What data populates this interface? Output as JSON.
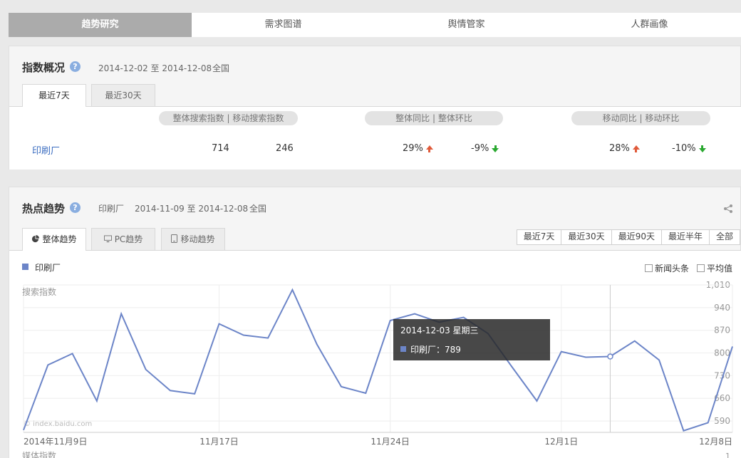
{
  "nav": {
    "items": [
      {
        "label": "趋势研究",
        "active": true
      },
      {
        "label": "需求图谱",
        "active": false
      },
      {
        "label": "舆情管家",
        "active": false
      },
      {
        "label": "人群画像",
        "active": false
      }
    ]
  },
  "overview": {
    "title": "指数概况",
    "help": "?",
    "date_range": "2014-12-02 至 2014-12-08",
    "region": "全国",
    "tabs": [
      {
        "label": "最近7天",
        "active": true
      },
      {
        "label": "最近30天",
        "active": false
      }
    ],
    "headers": {
      "search": "整体搜索指数 | 移动搜索指数",
      "overall": "整体同比 | 整体环比",
      "mobile": "移动同比 | 移动环比"
    },
    "row": {
      "keyword": "印刷厂",
      "overall_search": "714",
      "mobile_search": "246",
      "overall_yoy": "29%",
      "overall_mom": "-9%",
      "mobile_yoy": "28%",
      "mobile_mom": "-10%"
    },
    "colors": {
      "up": "#e05a3a",
      "down": "#2aa830",
      "link": "#3a6cc0"
    }
  },
  "trend": {
    "title": "热点趋势",
    "help": "?",
    "keyword": "印刷厂",
    "date_range": "2014-11-09 至 2014-12-08",
    "region": "全国",
    "tabs": [
      {
        "label": "整体趋势",
        "icon": "pie-chart-icon",
        "active": true
      },
      {
        "label": "PC趋势",
        "icon": "monitor-icon",
        "active": false
      },
      {
        "label": "移动趋势",
        "icon": "mobile-icon",
        "active": false
      }
    ],
    "ranges": [
      "最近7天",
      "最近30天",
      "最近90天",
      "最近半年",
      "全部"
    ],
    "legend": "印刷厂",
    "checkboxes": [
      "新闻头条",
      "平均值"
    ],
    "y_axis_label": "搜索指数",
    "watermark": "© index.baidu.com",
    "bottom_cut_label": "媒体指数",
    "bottom_cut_value": "1",
    "tooltip": {
      "date": "2014-12-03 星期三",
      "label": "印刷厂：789"
    }
  },
  "chart_data": {
    "type": "line",
    "ylabel": "搜索指数",
    "ylim": [
      555,
      1010
    ],
    "y_ticks": [
      "590",
      "660",
      "730",
      "800",
      "870",
      "940",
      "1,010"
    ],
    "y_tick_values": [
      590,
      660,
      730,
      800,
      870,
      940,
      1010
    ],
    "x_tick_labels": [
      "2014年11月9日",
      "11月17日",
      "11月24日",
      "12月1日",
      "12月8日"
    ],
    "x_tick_dates": [
      "2014-11-09",
      "2014-11-17",
      "2014-11-24",
      "2014-12-01",
      "2014-12-08"
    ],
    "series": [
      {
        "name": "印刷厂",
        "color": "#6c85c8",
        "x": [
          "2014-11-09",
          "2014-11-10",
          "2014-11-11",
          "2014-11-12",
          "2014-11-13",
          "2014-11-14",
          "2014-11-15",
          "2014-11-16",
          "2014-11-17",
          "2014-11-18",
          "2014-11-19",
          "2014-11-20",
          "2014-11-21",
          "2014-11-22",
          "2014-11-23",
          "2014-11-24",
          "2014-11-25",
          "2014-11-26",
          "2014-11-27",
          "2014-11-28",
          "2014-11-29",
          "2014-11-30",
          "2014-12-01",
          "2014-12-02",
          "2014-12-03",
          "2014-12-04",
          "2014-12-05",
          "2014-12-06",
          "2014-12-07",
          "2014-12-08"
        ],
        "values": [
          562,
          763,
          798,
          652,
          921,
          749,
          684,
          674,
          890,
          855,
          846,
          995,
          827,
          696,
          676,
          900,
          921,
          895,
          910,
          860,
          755,
          652,
          804,
          787,
          789,
          837,
          778,
          560,
          585,
          820
        ]
      }
    ],
    "highlight": {
      "x": "2014-12-03",
      "value": 789
    }
  }
}
